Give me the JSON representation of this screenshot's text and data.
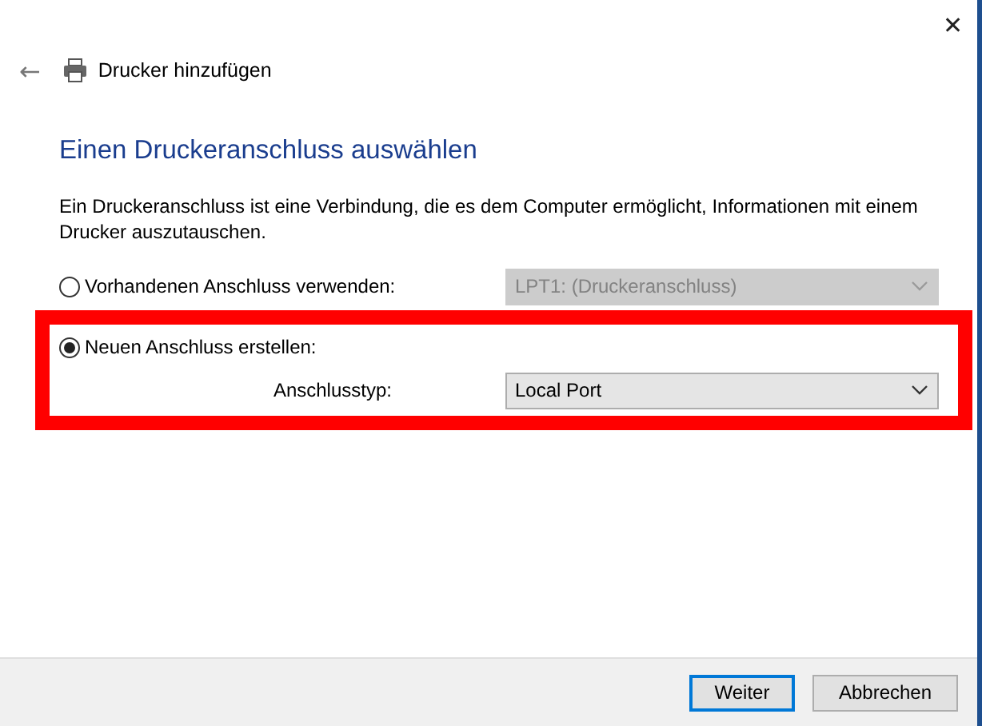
{
  "window": {
    "title": "Drucker hinzufügen",
    "close": "✕",
    "back": "←"
  },
  "heading": "Einen Druckeranschluss auswählen",
  "description": "Ein Druckeranschluss ist eine Verbindung, die es dem Computer ermöglicht, Informationen mit einem Drucker auszutauschen.",
  "existing_port": {
    "label": "Vorhandenen Anschluss verwenden:",
    "selected": false,
    "dropdown": {
      "value": "LPT1: (Druckeranschluss)",
      "disabled": true
    }
  },
  "new_port": {
    "label": "Neuen Anschluss erstellen:",
    "selected": true,
    "highlighted": true,
    "type_label": "Anschlusstyp:",
    "dropdown": {
      "value": "Local Port",
      "disabled": false
    }
  },
  "buttons": [
    {
      "label": "Weiter",
      "default": true
    },
    {
      "label": "Abbrechen",
      "default": false
    }
  ]
}
